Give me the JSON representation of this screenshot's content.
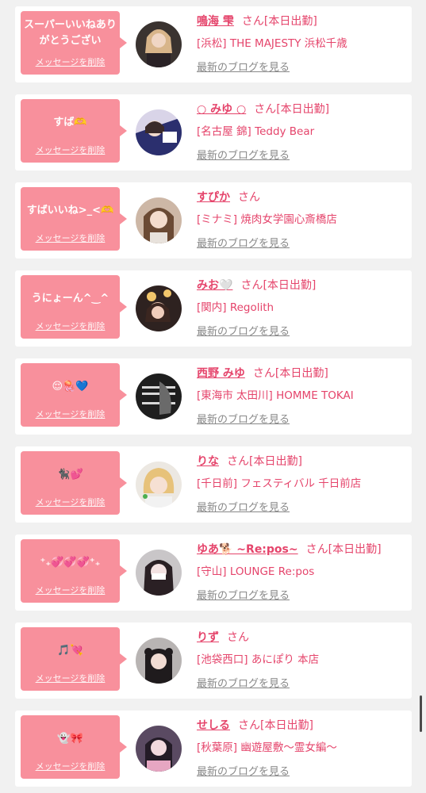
{
  "delete_label": "メッセージを削除",
  "blog_label": "最新のブログを見る",
  "san_label": "さん",
  "colors": {
    "accent": "#e5446b",
    "bubble": "#f8909c",
    "link_gray": "#888888"
  },
  "items": [
    {
      "message": "スーパーいいねありがとうござい",
      "name": "鳴海 雫",
      "status": "[本日出勤]",
      "shop": "[浜松] THE MAJESTY 浜松千歳"
    },
    {
      "message": "すば🫶",
      "name": "○ みゆ ○",
      "status": "[本日出勤]",
      "shop": "[名古屋 錦] Teddy Bear"
    },
    {
      "message": "すばいいね>_<🫶",
      "name": "すぴか",
      "status": "",
      "shop": "[ミナミ] 焼肉女学園心斎橋店"
    },
    {
      "message": "うにょーん^‿^",
      "name": "みお🤍",
      "status": "[本日出勤]",
      "shop": "[関内] Regolith"
    },
    {
      "message": "😌🪼💙",
      "name": "西野 みゆ",
      "status": "[本日出勤]",
      "shop": "[東海市 太田川] HOMME TOKAI"
    },
    {
      "message": "🐈‍⬛💕",
      "name": "りな",
      "status": "[本日出勤]",
      "shop": "[千日前] フェスティバル 千日前店"
    },
    {
      "message": "⁺₊💞💞💞⁺₊",
      "name": "ゆあ🐕 ~Re:pos~",
      "status": "[本日出勤]",
      "shop": "[守山] LOUNGE Re:pos"
    },
    {
      "message": "🎵💘",
      "name": "りず",
      "status": "",
      "shop": "[池袋西口] あにぽり 本店"
    },
    {
      "message": "👻🎀",
      "name": "せしる",
      "status": "[本日出勤]",
      "shop": "[秋葉原] 幽遊屋敷〜霊女編〜"
    }
  ]
}
